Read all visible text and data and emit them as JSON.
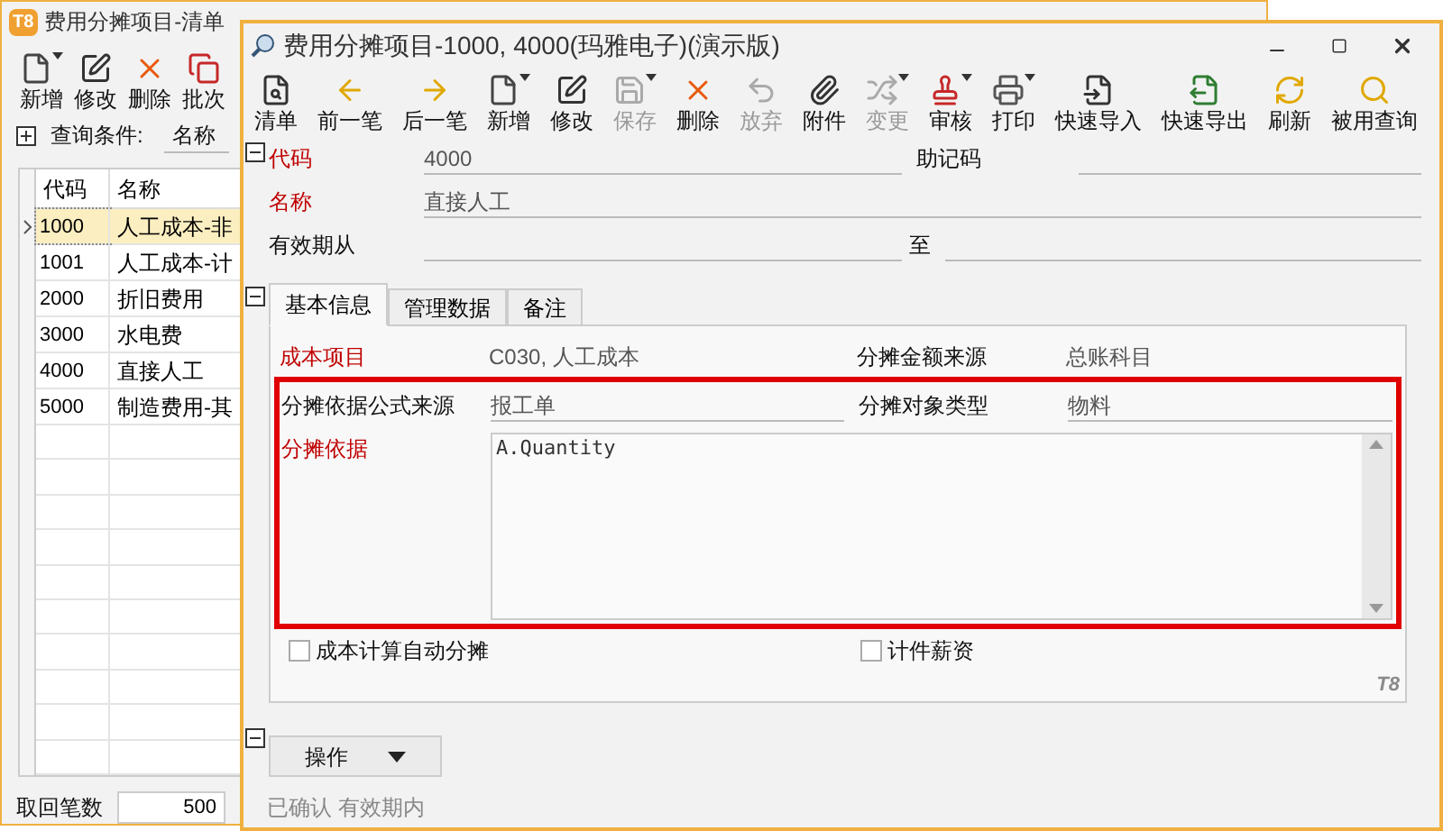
{
  "back_window": {
    "logo": "T8",
    "title": "费用分摊项目-清单",
    "toolbar": [
      {
        "label": "新增",
        "kind": "dropdown"
      },
      {
        "label": "修改",
        "kind": "plain"
      },
      {
        "label": "删除",
        "kind": "plain"
      },
      {
        "label": "批次",
        "kind": "plain"
      }
    ],
    "query": {
      "label": "查询条件:",
      "field": "名称"
    },
    "table": {
      "columns": [
        "代码",
        "名称"
      ],
      "rows": [
        {
          "code": "1000",
          "name": "人工成本-非",
          "selected": true
        },
        {
          "code": "1001",
          "name": "人工成本-计",
          "selected": false
        },
        {
          "code": "2000",
          "name": "折旧费用",
          "selected": false
        },
        {
          "code": "3000",
          "name": "水电费",
          "selected": false
        },
        {
          "code": "4000",
          "name": "直接人工",
          "selected": false
        },
        {
          "code": "5000",
          "name": "制造费用-其",
          "selected": false
        }
      ]
    },
    "footer": {
      "label": "取回笔数",
      "value": "500"
    }
  },
  "window": {
    "title": "费用分摊项目-1000, 4000(玛雅电子)(演示版)",
    "toolbar": [
      {
        "label": "清单",
        "kind": "plain",
        "disabled": false
      },
      {
        "label": "前一笔",
        "kind": "plain",
        "disabled": false
      },
      {
        "label": "后一笔",
        "kind": "plain",
        "disabled": false
      },
      {
        "label": "新增",
        "kind": "dropdown",
        "disabled": false
      },
      {
        "label": "修改",
        "kind": "plain",
        "disabled": false
      },
      {
        "label": "保存",
        "kind": "dropdown",
        "disabled": true
      },
      {
        "label": "删除",
        "kind": "plain",
        "disabled": false
      },
      {
        "label": "放弃",
        "kind": "plain",
        "disabled": true
      },
      {
        "label": "附件",
        "kind": "plain",
        "disabled": false
      },
      {
        "label": "变更",
        "kind": "dropdown",
        "disabled": true
      },
      {
        "label": "审核",
        "kind": "dropdown",
        "disabled": false
      },
      {
        "label": "打印",
        "kind": "dropdown",
        "disabled": false
      },
      {
        "label": "快速导入",
        "kind": "plain",
        "disabled": false
      },
      {
        "label": "快速导出",
        "kind": "plain",
        "disabled": false
      },
      {
        "label": "刷新",
        "kind": "plain",
        "disabled": false
      },
      {
        "label": "被用查询",
        "kind": "plain",
        "disabled": false
      }
    ],
    "header_fields": [
      [
        {
          "label": "代码",
          "required": true,
          "value": "4000"
        },
        {
          "label": "助记码",
          "required": false
        }
      ],
      [
        {
          "label": "名称",
          "required": true,
          "value": "直接人工"
        }
      ],
      [
        {
          "label": "有效期从",
          "required": false
        },
        {
          "label": "至",
          "required": false
        }
      ]
    ],
    "tabs": [
      {
        "label": "基本信息",
        "selected": true
      },
      {
        "label": "管理数据",
        "selected": false
      },
      {
        "label": "备注",
        "selected": false
      }
    ],
    "tab_fields": [
      [
        {
          "label": "成本项目",
          "required": true,
          "value": "C030, 人工成本"
        },
        {
          "label": "分摊金额来源",
          "required": false,
          "value": "总账科目"
        }
      ],
      [
        {
          "label": "分摊依据公式来源",
          "required": false,
          "value": "报工单"
        },
        {
          "label": "分摊对象类型",
          "required": false,
          "value": "物料"
        }
      ]
    ],
    "formula": {
      "label": "分摊依据",
      "required": true,
      "value": "A.Quantity"
    },
    "checkboxes": [
      {
        "label": "成本计算自动分摊",
        "checked": false
      },
      {
        "label": "计件薪资",
        "checked": false
      }
    ],
    "logo": "T8",
    "action_button": "操作",
    "status": "已确认 有效期内"
  }
}
